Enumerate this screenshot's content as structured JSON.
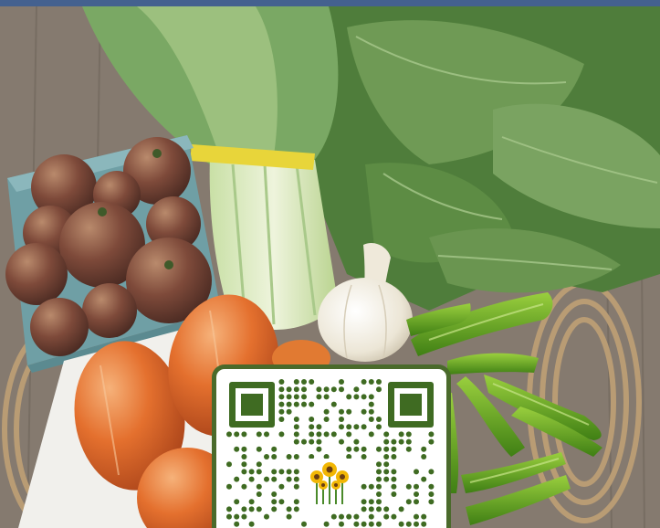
{
  "photo": {
    "subject": "farm-share-vegetables",
    "items": [
      "tomatoes",
      "bok-choy",
      "collard-greens",
      "garlic",
      "green-peppers",
      "orange-tomatoes"
    ]
  },
  "qr_code": {
    "logo_icon": "sunflower-icon",
    "color": "#3f6b22"
  },
  "colors": {
    "top_bar": "#44618f",
    "qr_frame": "#4a6a2b",
    "wood": "#8a8074"
  }
}
